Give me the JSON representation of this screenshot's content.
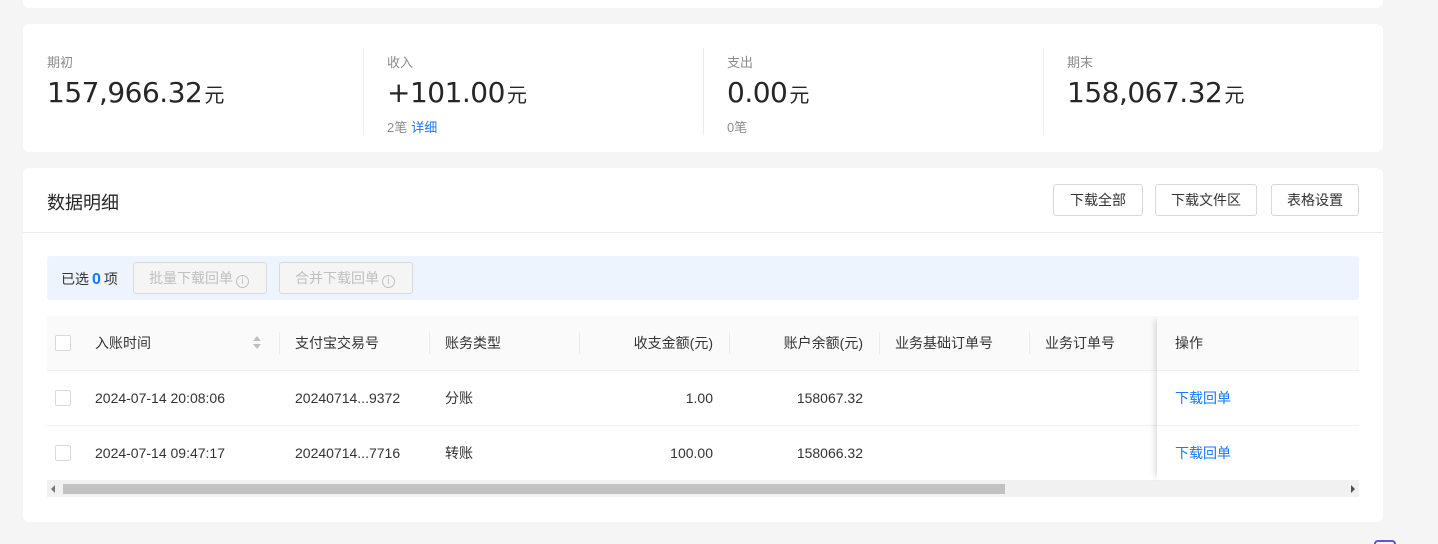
{
  "summary": {
    "opening": {
      "label": "期初",
      "value": "157,966.32",
      "unit": "元"
    },
    "income": {
      "label": "收入",
      "value": "+101.00",
      "unit": "元",
      "count": "2笔",
      "detail_link": "详细"
    },
    "expense": {
      "label": "支出",
      "value": "0.00",
      "unit": "元",
      "count": "0笔"
    },
    "closing": {
      "label": "期末",
      "value": "158,067.32",
      "unit": "元"
    }
  },
  "detail": {
    "title": "数据明细",
    "buttons": {
      "download_all": "下载全部",
      "download_files": "下载文件区",
      "table_settings": "表格设置"
    },
    "selection": {
      "prefix": "已选",
      "count": "0",
      "suffix": "项",
      "batch_download": "批量下载回单",
      "merge_download": "合并下载回单",
      "info_icon": "i"
    }
  },
  "table": {
    "columns": [
      "入账时间",
      "支付宝交易号",
      "账务类型",
      "收支金额(元)",
      "账户余额(元)",
      "业务基础订单号",
      "业务订单号",
      "操作"
    ],
    "rows": [
      {
        "time": "2024-07-14 20:08:06",
        "trade_no": "20240714...9372",
        "type": "分账",
        "amount": "1.00",
        "balance": "158067.32",
        "base_order": "",
        "order": "",
        "action": "下载回单"
      },
      {
        "time": "2024-07-14 09:47:17",
        "trade_no": "20240714...7716",
        "type": "转账",
        "amount": "100.00",
        "balance": "158066.32",
        "base_order": "",
        "order": "",
        "action": "下载回单"
      }
    ]
  },
  "colors": {
    "accent": "#1677ff",
    "selection_bg": "#eef4fe",
    "page_bg": "#f5f5f5"
  }
}
